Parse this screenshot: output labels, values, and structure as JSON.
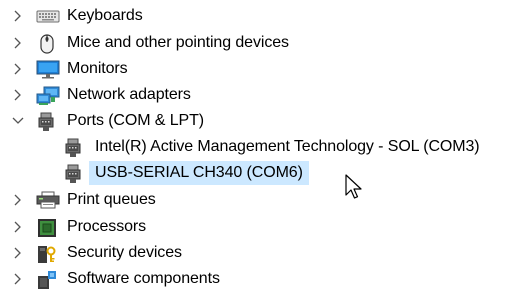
{
  "tree": {
    "items": [
      {
        "label": "Keyboards",
        "icon": "keyboard-icon",
        "expander": "collapsed"
      },
      {
        "label": "Mice and other pointing devices",
        "icon": "mouse-icon",
        "expander": "collapsed"
      },
      {
        "label": "Monitors",
        "icon": "monitor-icon",
        "expander": "collapsed"
      },
      {
        "label": "Network adapters",
        "icon": "network-adapter-icon",
        "expander": "collapsed"
      },
      {
        "label": "Ports (COM & LPT)",
        "icon": "port-icon",
        "expander": "expanded",
        "children": [
          {
            "label": "Intel(R) Active Management Technology - SOL (COM3)",
            "icon": "port-icon"
          },
          {
            "label": "USB-SERIAL CH340 (COM6)",
            "icon": "port-icon",
            "selected": true
          }
        ]
      },
      {
        "label": "Print queues",
        "icon": "printer-icon",
        "expander": "collapsed"
      },
      {
        "label": "Processors",
        "icon": "processor-icon",
        "expander": "collapsed"
      },
      {
        "label": "Security devices",
        "icon": "security-device-icon",
        "expander": "collapsed"
      },
      {
        "label": "Software components",
        "icon": "software-component-icon",
        "expander": "collapsed"
      }
    ]
  },
  "colors": {
    "selection": "#cce8ff",
    "chevron": "#555555",
    "text": "#000000"
  }
}
